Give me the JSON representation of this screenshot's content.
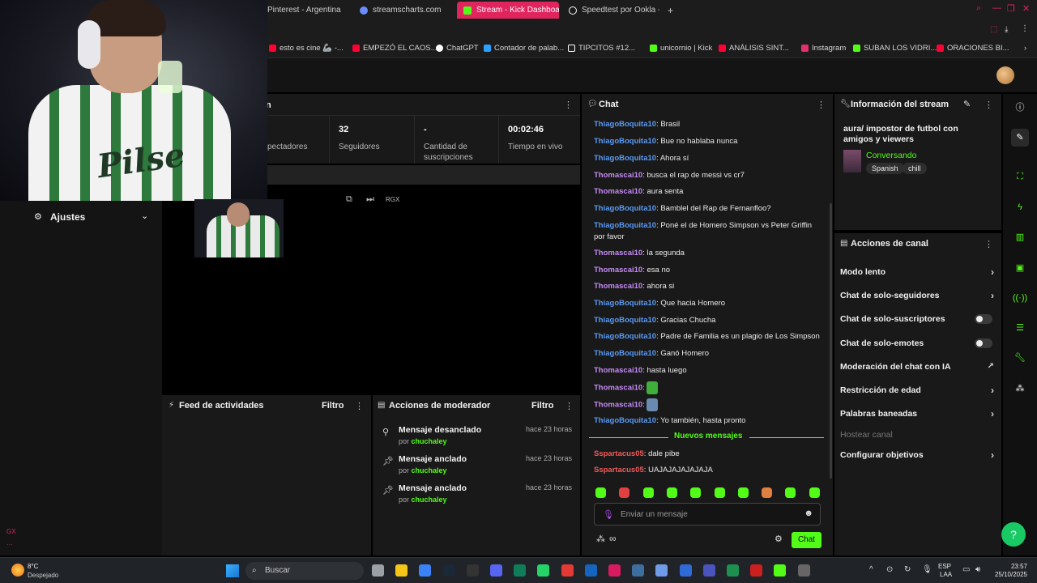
{
  "browser": {
    "tabs": [
      {
        "label": "Pinterest - Argentina",
        "color": "#e60023"
      },
      {
        "label": "streamscharts.com",
        "color": "#6b8cff"
      },
      {
        "label": "Stream - Kick Dashboard",
        "color": "#53fc18"
      },
      {
        "label": "Speedtest por Ookla - La",
        "color": "#ffffff"
      }
    ],
    "new_tab": "+",
    "bookmarks": [
      {
        "label": "esto es cine 🦾 -...",
        "color": "#ff0033"
      },
      {
        "label": "EMPEZÓ EL CAOS...",
        "color": "#ff0033"
      },
      {
        "label": "ChatGPT",
        "color": "#ffffff"
      },
      {
        "label": "Contador de palab...",
        "color": "#2aa1ff"
      },
      {
        "label": "TIPCITOS #12...",
        "color": "#ffffff"
      },
      {
        "label": "unicornio | Kick",
        "color": "#53fc18"
      },
      {
        "label": "ANÁLISIS SINT...",
        "color": "#ff0033"
      },
      {
        "label": "Instagram",
        "color": "#e1306c"
      },
      {
        "label": "SUBAN LOS VIDRI...",
        "color": "#53fc18"
      },
      {
        "label": "ORACIONES BI...",
        "color": "#ff0033"
      }
    ]
  },
  "sidebar": {
    "ajustes": "Ajustes"
  },
  "stats": {
    "section_fragment": "n",
    "viewers_label": "pectadores",
    "followers_value": "32",
    "followers_label": "Seguidores",
    "subs_value": "-",
    "subs_label": "Cantidad de suscripciones",
    "uptime_value": "00:02:46",
    "uptime_label": "Tiempo en vivo"
  },
  "player": {
    "rgx": "RGX"
  },
  "activity_feed": {
    "title": "Feed de actividades",
    "filter": "Filtro"
  },
  "mod_actions": {
    "title": "Acciones de moderador",
    "filter": "Filtro",
    "items": [
      {
        "title": "Mensaje desanclado",
        "by_prefix": "por",
        "by": "chuchaley",
        "time": "hace 23 horas"
      },
      {
        "title": "Mensaje anclado",
        "by_prefix": "por",
        "by": "chuchaley",
        "time": "hace 23 horas"
      },
      {
        "title": "Mensaje anclado",
        "by_prefix": "por",
        "by": "chuchaley",
        "time": "hace 23 horas"
      }
    ]
  },
  "chat": {
    "title": "Chat",
    "messages": [
      {
        "user": "ThiagoBoquita10",
        "color": "#5a9bf5",
        "text": "Brasil"
      },
      {
        "user": "ThiagoBoquita10",
        "color": "#5a9bf5",
        "text": "Bue no hablaba nunca"
      },
      {
        "user": "ThiagoBoquita10",
        "color": "#5a9bf5",
        "text": "Ahora sí"
      },
      {
        "user": "Thomascai10",
        "color": "#c58bf5",
        "text": "busca el rap de messi vs cr7"
      },
      {
        "user": "Thomascai10",
        "color": "#c58bf5",
        "text": "aura senta"
      },
      {
        "user": "ThiagoBoquita10",
        "color": "#5a9bf5",
        "text": "Bamblel del Rap de Fernanfloo?"
      },
      {
        "user": "ThiagoBoquita10",
        "color": "#5a9bf5",
        "text": "Poné el de Homero Simpson vs Peter Griffin por favor"
      },
      {
        "user": "Thomascai10",
        "color": "#c58bf5",
        "text": "la segunda"
      },
      {
        "user": "Thomascai10",
        "color": "#c58bf5",
        "text": "esa no"
      },
      {
        "user": "Thomascai10",
        "color": "#c58bf5",
        "text": "ahora si"
      },
      {
        "user": "ThiagoBoquita10",
        "color": "#5a9bf5",
        "text": "Que hacia Homero"
      },
      {
        "user": "ThiagoBoquita10",
        "color": "#5a9bf5",
        "text": "Gracias Chucha"
      },
      {
        "user": "ThiagoBoquita10",
        "color": "#5a9bf5",
        "text": "Padre de Familia es un plagio de Los Simpson"
      },
      {
        "user": "ThiagoBoquita10",
        "color": "#5a9bf5",
        "text": "Ganó Homero"
      },
      {
        "user": "Thomascai10",
        "color": "#c58bf5",
        "text": "hasta luego"
      },
      {
        "user": "Thomascai10",
        "color": "#c58bf5",
        "text": ""
      },
      {
        "user": "Thomascai10",
        "color": "#c58bf5",
        "text": ""
      },
      {
        "user": "ThiagoBoquita10",
        "color": "#5a9bf5",
        "text": "Yo también, hasta pronto"
      }
    ],
    "new_messages_label": "Nuevos mensajes",
    "new_messages": [
      {
        "user": "Sspartacus05",
        "color": "#f25a5a",
        "text": "dale pibe"
      },
      {
        "user": "Sspartacus05",
        "color": "#f25a5a",
        "text": "UAJAJAJAJAJAJA"
      }
    ],
    "input_placeholder": "Enviar un mensaje",
    "send_label": "Chat"
  },
  "stream_info": {
    "title": "Información del stream",
    "stream_title": "aura/ impostor de futbol con amigos y viewers",
    "category": "Conversando",
    "tags": [
      "Spanish",
      "chill"
    ]
  },
  "channel_actions": {
    "title": "Acciones de canal",
    "items": [
      {
        "label": "Modo lento",
        "kind": "chevron"
      },
      {
        "label": "Chat de solo-seguidores",
        "kind": "chevron"
      },
      {
        "label": "Chat de solo-suscriptores",
        "kind": "toggle"
      },
      {
        "label": "Chat de solo-emotes",
        "kind": "toggle"
      },
      {
        "label": "Moderación del chat con IA",
        "kind": "external"
      },
      {
        "label": "Restricción de edad",
        "kind": "chevron"
      },
      {
        "label": "Palabras baneadas",
        "kind": "chevron"
      },
      {
        "label": "Hostear canal",
        "kind": "disabled"
      },
      {
        "label": "Configurar objetivos",
        "kind": "chevron"
      }
    ]
  },
  "taskbar": {
    "weather_temp": "8°C",
    "weather_desc": "Despejado",
    "search": "Buscar",
    "lang": "ESP",
    "lang2": "LAA",
    "time": "23:57",
    "date": "25/10/2025"
  },
  "colors": {
    "kick_green": "#53fc18",
    "accent_pink": "#e0245e"
  }
}
